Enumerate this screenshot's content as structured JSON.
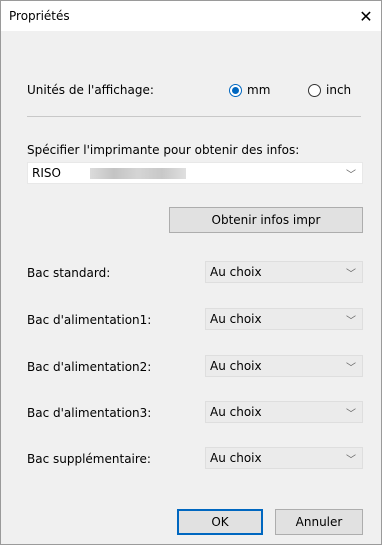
{
  "window": {
    "title": "Propriétés",
    "close_glyph": "✕"
  },
  "display_units": {
    "label": "Unités de l'affichage:",
    "options": [
      {
        "label": "mm",
        "selected": true
      },
      {
        "label": "inch",
        "selected": false
      }
    ]
  },
  "printer": {
    "label": "Spécifier l'imprimante pour obtenir des infos:",
    "selected_value": "RISO",
    "get_info_button": "Obtenir infos impr"
  },
  "trays": [
    {
      "label": "Bac standard:",
      "value": "Au choix"
    },
    {
      "label": "Bac d'alimentation1:",
      "value": "Au choix"
    },
    {
      "label": "Bac d'alimentation2:",
      "value": "Au choix"
    },
    {
      "label": "Bac d'alimentation3:",
      "value": "Au choix"
    },
    {
      "label": "Bac supplémentaire:",
      "value": "Au choix"
    }
  ],
  "footer": {
    "ok_label": "OK",
    "cancel_label": "Annuler"
  },
  "colors": {
    "accent": "#0067c0",
    "dialog_bg": "#f0f0f0",
    "titlebar_bg": "#ffffff"
  },
  "icons": {
    "close": "close-icon",
    "dropdown": "chevron-down-icon",
    "radio": "radio-button"
  }
}
